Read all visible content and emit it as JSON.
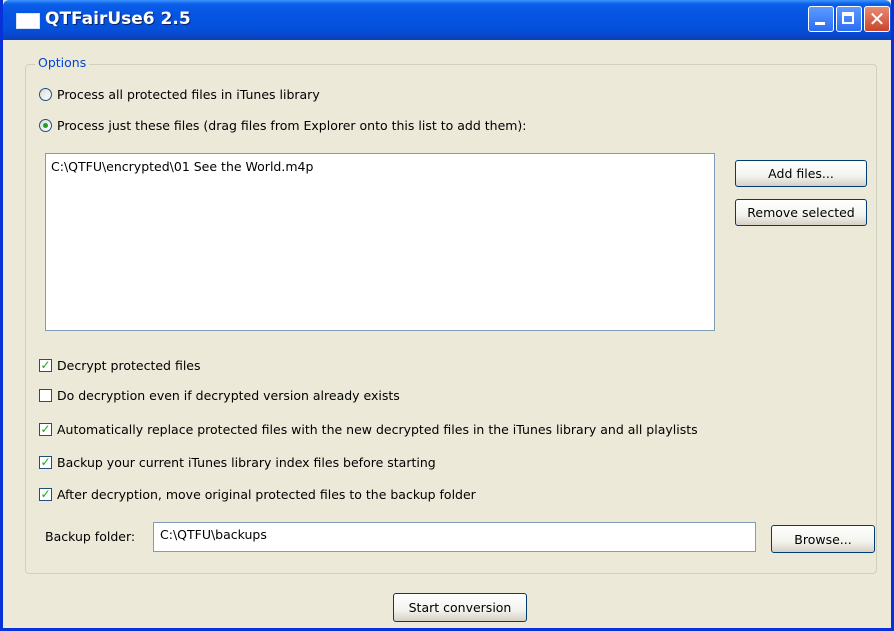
{
  "window": {
    "title": "QTFairUse6 2.5"
  },
  "options_group": {
    "legend": "Options",
    "radio_all": "Process all protected files in iTunes library",
    "radio_just": "Process just these files (drag files from Explorer onto this list to add them):",
    "selected_radio": "radio_just"
  },
  "file_list": {
    "items": [
      "C:\\QTFU\\encrypted\\01 See the World.m4p"
    ]
  },
  "buttons": {
    "add_files": "Add files...",
    "remove_selected": "Remove selected",
    "browse": "Browse...",
    "start_conversion": "Start conversion"
  },
  "checkboxes": {
    "decrypt": {
      "label": "Decrypt protected files",
      "checked": true
    },
    "force_decrypt": {
      "label": "Do decryption even if decrypted version already exists",
      "checked": false
    },
    "auto_replace": {
      "label": "Automatically replace protected files with the new decrypted files in the iTunes library and all playlists",
      "checked": true
    },
    "backup_index": {
      "label": "Backup your current iTunes library index files before starting",
      "checked": true
    },
    "move_originals": {
      "label": "After decryption, move original protected files to the backup folder",
      "checked": true
    }
  },
  "backup_folder": {
    "label": "Backup folder:",
    "value": "C:\\QTFU\\backups"
  },
  "colors": {
    "titlebar": "#0553e1",
    "accent_text": "#0046d5",
    "check_mark": "#21a121",
    "face": "#ece9d8"
  }
}
